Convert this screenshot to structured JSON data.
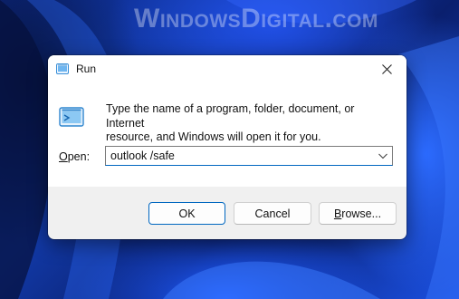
{
  "watermark": "WindowsDigital.com",
  "dialog": {
    "title": "Run",
    "title_icon": "run-icon",
    "close_icon": "close-icon",
    "prompt_line1": "Type the name of a program, folder, document, or Internet",
    "prompt_line2": "resource, and Windows will open it for you.",
    "open_label_accel": "O",
    "open_label_rest": "pen:",
    "command_value": "outlook /safe",
    "ok_label": "OK",
    "cancel_label": "Cancel",
    "browse_label_accel": "B",
    "browse_label_rest": "rowse..."
  },
  "colors": {
    "accent": "#0067c0",
    "dialog_bg": "#f0f0f0",
    "wallpaper": "#1a4fe0"
  }
}
